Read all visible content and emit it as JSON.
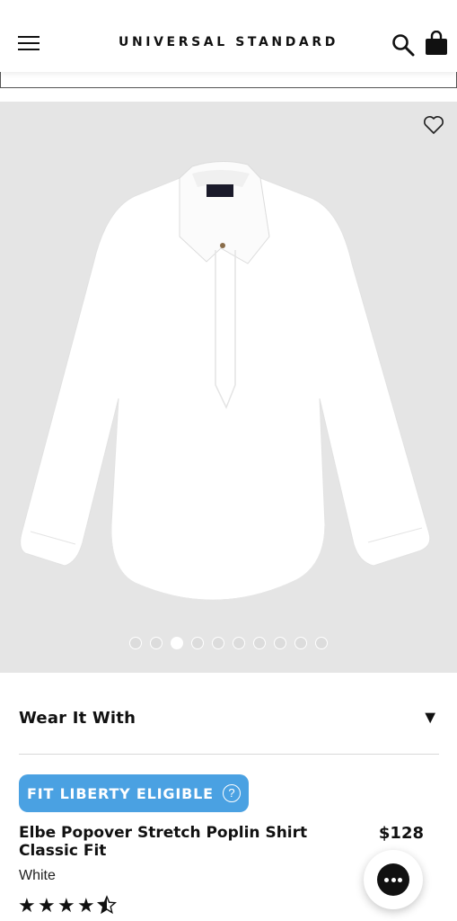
{
  "header": {
    "brand": "UNIVERSAL STANDARD",
    "menu_icon": "hamburger-menu-icon",
    "search_icon": "search-icon",
    "bag_icon": "shopping-bag-icon"
  },
  "gallery": {
    "favorite_icon": "heart-icon",
    "image_description": "white shirt product photo",
    "dot_count": 10,
    "active_dot": 3
  },
  "wear_it_with": {
    "label": "Wear It With",
    "arrow": "▼"
  },
  "badge": {
    "label": "FIT LIBERTY ELIGIBLE",
    "help": "?"
  },
  "product": {
    "title": "Elbe Popover Stretch Poplin Shirt Classic Fit",
    "price": "$128",
    "color": "White",
    "rating": 4.5,
    "rating_max": 5
  },
  "chat": {
    "icon": "chat-bubble-icon"
  },
  "colors": {
    "badge_blue": "#4aa1e2",
    "gallery_bg": "#e5e5e5",
    "text": "#111111"
  }
}
